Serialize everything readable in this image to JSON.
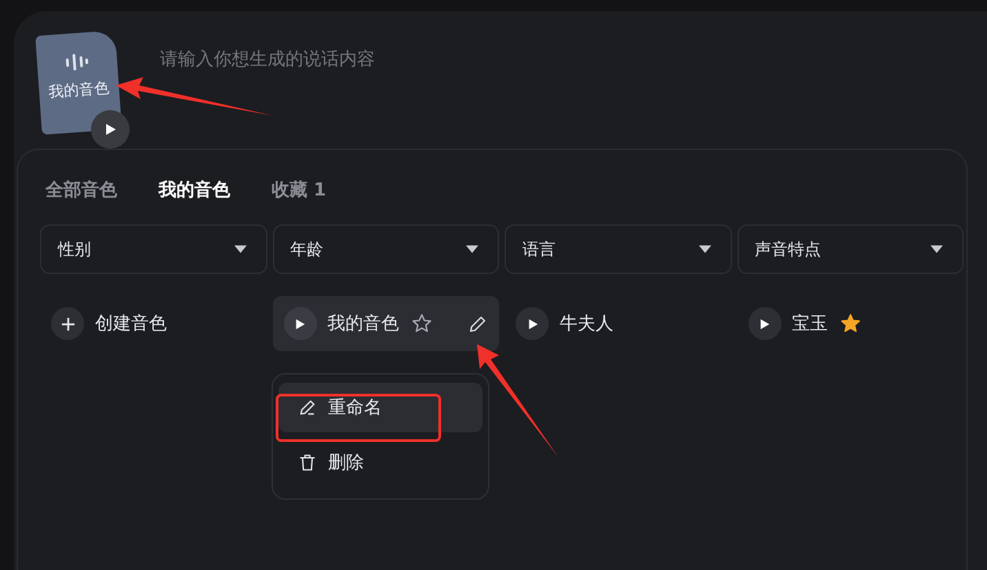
{
  "prompt": {
    "placeholder": "请输入你想生成的说话内容"
  },
  "voice_file": {
    "label": "我的音色"
  },
  "tabs": [
    {
      "label": "全部音色",
      "selected": false
    },
    {
      "label": "我的音色",
      "selected": true
    },
    {
      "label": "收藏 1",
      "selected": false
    }
  ],
  "filters": [
    {
      "label": "性别"
    },
    {
      "label": "年龄"
    },
    {
      "label": "语言"
    },
    {
      "label": "声音特点"
    }
  ],
  "voices": [
    {
      "kind": "create",
      "name": "创建音色"
    },
    {
      "kind": "voice",
      "name": "我的音色",
      "hovered": true,
      "favorite": false
    },
    {
      "kind": "voice",
      "name": "牛夫人",
      "hovered": false,
      "favorite": false
    },
    {
      "kind": "voice",
      "name": "宝玉",
      "hovered": false,
      "favorite": true
    }
  ],
  "menu": [
    {
      "kind": "rename",
      "label": "重命名",
      "highlighted": true
    },
    {
      "kind": "delete",
      "label": "删除",
      "highlighted": false
    }
  ]
}
